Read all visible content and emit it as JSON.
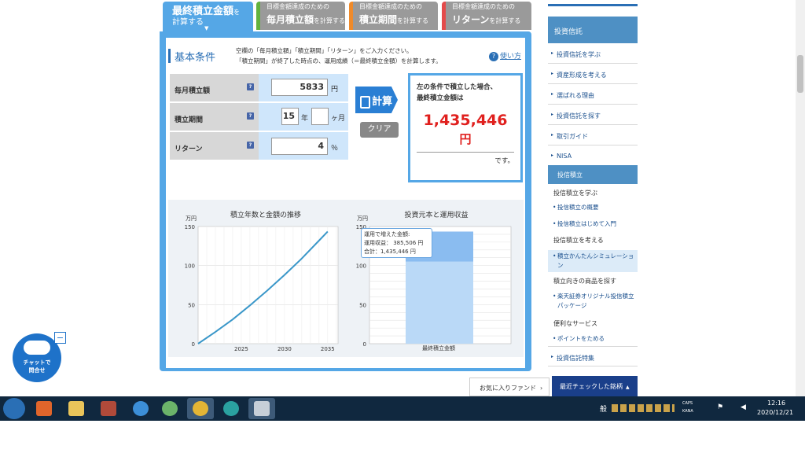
{
  "tabs": [
    {
      "sub": "",
      "main": "最終積立金額",
      "suffix": "を",
      "line2": "計算する"
    },
    {
      "sub": "目標金額達成のための",
      "main": "毎月積立額",
      "suffix": "を計算する"
    },
    {
      "sub": "目標金額達成のための",
      "main": "積立期間",
      "suffix": "を計算する"
    },
    {
      "sub": "目標金額達成のための",
      "main": "リターン",
      "suffix": "を計算する"
    }
  ],
  "basic": {
    "title": "基本条件",
    "desc1": "空欄の「毎月積立額」「積立期間」「リターン」をご入力ください。",
    "desc2": "「積立期間」が終了した時点の、運用成績（＝最終積立金額）を計算します。",
    "help": "使い方"
  },
  "fields": {
    "monthly": {
      "label": "毎月積立額",
      "value": "5833",
      "unit": "円"
    },
    "period": {
      "label": "積立期間",
      "years": "15",
      "years_unit": "年",
      "months": "",
      "months_unit": "ヶ月"
    },
    "return": {
      "label": "リターン",
      "value": "4",
      "unit": "％"
    }
  },
  "buttons": {
    "calc": "計算",
    "clear": "クリア"
  },
  "result": {
    "line1": "左の条件で積立した場合、",
    "line2": "最終積立金額は",
    "amount": "1,435,446",
    "yen": "円",
    "desu": "です。"
  },
  "chart_data": [
    {
      "type": "line",
      "title": "積立年数と金額の推移",
      "ylabel": "万円",
      "x_ticks": [
        "2025",
        "2030",
        "2035"
      ],
      "y_ticks": [
        "0",
        "50",
        "100",
        "150"
      ],
      "ylim": [
        0,
        150
      ],
      "series": [
        {
          "x": [
            2020,
            2022,
            2024,
            2026,
            2028,
            2030,
            2032,
            2034,
            2035
          ],
          "values": [
            0,
            15,
            31,
            49,
            68,
            88,
            109,
            132,
            143.5
          ]
        }
      ]
    },
    {
      "type": "bar",
      "title": "投資元本と運用収益",
      "ylabel": "万円",
      "categories": [
        "最終積立金額"
      ],
      "y_ticks": [
        "0",
        "50",
        "100",
        "150"
      ],
      "ylim": [
        0,
        150
      ],
      "series": [
        {
          "values": [
            105
          ]
        },
        {
          "values": [
            38.5
          ]
        }
      ],
      "tooltip": {
        "l1": "運用で増えた金額:",
        "l2": "運用収益：  385,506 円",
        "l3": "合計：1,435,446 円"
      }
    }
  ],
  "sidebar": {
    "header": "投資信託",
    "items": [
      "投資信託を学ぶ",
      "資産形成を考える",
      "選ばれる理由",
      "投資信託を探す",
      "取引ガイド",
      "NISA"
    ],
    "active": "投信積立",
    "groups": [
      {
        "title": "投信積立を学ぶ",
        "links": [
          "投信積立の概要",
          "投信積立はじめて入門"
        ]
      },
      {
        "title": "投信積立を考える",
        "links": [
          "積立かんたんシミュレーション"
        ]
      },
      {
        "title": "積立向きの商品を探す",
        "links": [
          "楽天証券オリジナル投信積立パッケージ"
        ]
      },
      {
        "title": "便利なサービス",
        "links": [
          "ポイントをためる"
        ]
      }
    ],
    "last": "投資信託特集"
  },
  "footer": {
    "fav": "お気に入りファンド",
    "recent": "最近チェックした銘柄"
  },
  "chat": {
    "line1": "チャットで",
    "line2": "問合せ",
    "minimize": "−"
  },
  "taskbar": {
    "time": "12:16",
    "date": "2020/12/21",
    "ime": "般",
    "caps": "CAPS",
    "kana": "KANA"
  },
  "colors": {
    "accent": "#55a7e6",
    "red": "#e0201e",
    "line": "#3a97c9",
    "bar_top": "#8abcf0",
    "bar_bottom": "#bad9f7"
  }
}
